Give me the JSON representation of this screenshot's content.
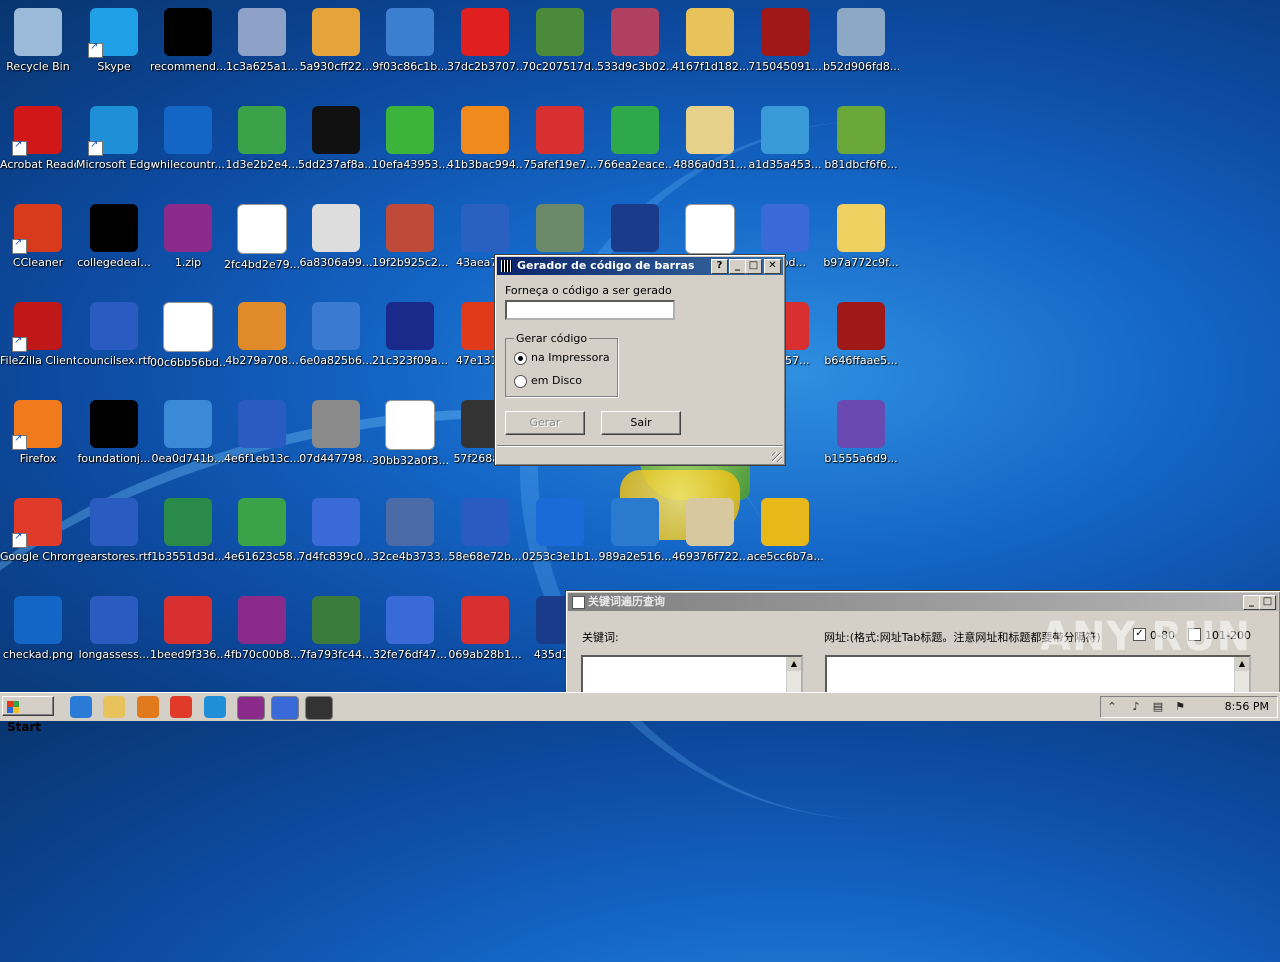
{
  "desktop": {
    "icons": [
      {
        "label": "Recycle Bin",
        "icon": "recycle-bin-icon",
        "color": "#9bb9d8",
        "shortcut": false
      },
      {
        "label": "Skype",
        "icon": "skype-icon",
        "color": "#1e9fe6",
        "shortcut": true
      },
      {
        "label": "recommend...",
        "icon": "black-thumbnail-icon",
        "color": "#000000",
        "shortcut": false
      },
      {
        "label": "1c3a625a1...",
        "icon": "noise-image-icon",
        "color": "#8ea2c8",
        "shortcut": false
      },
      {
        "label": "5a930cff22...",
        "icon": "package-icon",
        "color": "#e6a33a",
        "shortcut": false
      },
      {
        "label": "9f03c86c1b...",
        "icon": "media-player-icon",
        "color": "#3c7fd0",
        "shortcut": false
      },
      {
        "label": "37dc2b3707...",
        "icon": "color-squares-icon",
        "color": "#e02020",
        "shortcut": false
      },
      {
        "label": "70c207517d...",
        "icon": "battery-icon",
        "color": "#4a8a3a",
        "shortcut": false
      },
      {
        "label": "533d9c3b02...",
        "icon": "patterned-cube-icon",
        "color": "#b04060",
        "shortcut": false
      },
      {
        "label": "4167f1d182...",
        "icon": "folder-icon",
        "color": "#e8c25a",
        "shortcut": false
      },
      {
        "label": "715045091...",
        "icon": "pdf-app-icon",
        "color": "#a01818",
        "shortcut": false
      },
      {
        "label": "b52d906fd8...",
        "icon": "recycle-bin-full-icon",
        "color": "#8ca8c4",
        "shortcut": false
      },
      {
        "label": "Acrobat Reader DC",
        "icon": "acrobat-icon",
        "color": "#d01818",
        "shortcut": true
      },
      {
        "label": "Microsoft Edge",
        "icon": "edge-icon",
        "color": "#1f8fd8",
        "shortcut": true
      },
      {
        "label": "whilecountr...",
        "icon": "blank-file-icon",
        "color": "#1466c6",
        "shortcut": false
      },
      {
        "label": "1d3e2b2e4...",
        "icon": "shield-check-icon",
        "color": "#3aa34a",
        "shortcut": false
      },
      {
        "label": "5dd237af8a...",
        "icon": "letter-m-icon",
        "color": "#111111",
        "shortcut": false
      },
      {
        "label": "10efa43953...",
        "icon": "info-icon",
        "color": "#3cb43c",
        "shortcut": false
      },
      {
        "label": "41b3bac994...",
        "icon": "orange-box-icon",
        "color": "#f08a1c",
        "shortcut": false
      },
      {
        "label": "75afef19e7...",
        "icon": "pdf-file-icon",
        "color": "#d83030",
        "shortcut": false
      },
      {
        "label": "766ea2eace...",
        "icon": "green-arrows-icon",
        "color": "#2ea84a",
        "shortcut": false
      },
      {
        "label": "4886a0d31...",
        "icon": "open-book-icon",
        "color": "#e6d08a",
        "shortcut": false
      },
      {
        "label": "a1d35a453...",
        "icon": "lock-icon",
        "color": "#3a9ad8",
        "shortcut": false
      },
      {
        "label": "b81dbcf6f6...",
        "icon": "certificate-icon",
        "color": "#6aa83a",
        "shortcut": false
      },
      {
        "label": "CCleaner",
        "icon": "ccleaner-icon",
        "color": "#d83a1c",
        "shortcut": true
      },
      {
        "label": "collegedeal...",
        "icon": "black-thumbnail-icon",
        "color": "#000000",
        "shortcut": false
      },
      {
        "label": "1.zip",
        "icon": "winrar-icon",
        "color": "#8a2a8a",
        "shortcut": false
      },
      {
        "label": "2fc4bd2e79...",
        "icon": "window-icon",
        "color": "#ffffff",
        "shortcut": false
      },
      {
        "label": "6a8306a99...",
        "icon": "skull-crossbones-icon",
        "color": "#dddddd",
        "shortcut": false
      },
      {
        "label": "19f2b925c2...",
        "icon": "anime-face-icon",
        "color": "#c04a3a",
        "shortcut": false
      },
      {
        "label": "43aea7c...",
        "icon": "network-globe-icon",
        "color": "#2a60c0",
        "shortcut": false
      },
      {
        "label": "",
        "icon": "installer-icon",
        "color": "#6a8a6a",
        "shortcut": false
      },
      {
        "label": "",
        "icon": "clapperboard-icon",
        "color": "#1a3a8a",
        "shortcut": false
      },
      {
        "label": "",
        "icon": "app-window-icon",
        "color": "#ffffff",
        "shortcut": false
      },
      {
        "label": "...9bd...",
        "icon": "broom-icon",
        "color": "#3a6ad8",
        "shortcut": false
      },
      {
        "label": "b97a772c9f...",
        "icon": "folder-icon",
        "color": "#f0d060",
        "shortcut": false
      },
      {
        "label": "FileZilla Client",
        "icon": "filezilla-icon",
        "color": "#c01818",
        "shortcut": true
      },
      {
        "label": "councilsex.rtf",
        "icon": "word-doc-icon",
        "color": "#2a5bc0",
        "shortcut": false
      },
      {
        "label": "00c6bb56bd...",
        "icon": "text-doc-icon",
        "color": "#ffffff",
        "shortcut": false
      },
      {
        "label": "4b279a708...",
        "icon": "java-icon",
        "color": "#e08a2a",
        "shortcut": false
      },
      {
        "label": "6e0a825b6...",
        "icon": "calculator-icon",
        "color": "#3a7ad0",
        "shortcut": false
      },
      {
        "label": "21c323f09a...",
        "icon": "noise-image-icon",
        "color": "#1a2a8a",
        "shortcut": false
      },
      {
        "label": "47e131c...",
        "icon": "colorful-ball-icon",
        "color": "#e03a1a",
        "shortcut": false
      },
      {
        "label": "...5557...",
        "icon": "pdf-file-icon",
        "color": "#d83030",
        "shortcut": false
      },
      {
        "label": "b646ffaae5...",
        "icon": "noise-image-icon",
        "color": "#a01818",
        "shortcut": false
      },
      {
        "label": "Firefox",
        "icon": "firefox-icon",
        "color": "#f07a1c",
        "shortcut": true
      },
      {
        "label": "foundationj...",
        "icon": "black-thumbnail-icon",
        "color": "#000000",
        "shortcut": false
      },
      {
        "label": "0ea0d741b...",
        "icon": "windows-logo-icon",
        "color": "#3a8ad8",
        "shortcut": false
      },
      {
        "label": "4e6f1eb13c...",
        "icon": "word-doc-icon",
        "color": "#2a5bc0",
        "shortcut": false
      },
      {
        "label": "07d447798...",
        "icon": "server-icon",
        "color": "#8a8a8a",
        "shortcut": false
      },
      {
        "label": "30bb32a0f3...",
        "icon": "envelope-icon",
        "color": "#ffffff",
        "shortcut": false
      },
      {
        "label": "57f268a9...",
        "icon": "contact-card-icon",
        "color": "#333333",
        "shortcut": false
      },
      {
        "label": "b1555a6d9...",
        "icon": "stamp-2015-icon",
        "color": "#6a4ab0",
        "shortcut": false
      },
      {
        "label": "Google Chrome",
        "icon": "chrome-icon",
        "color": "#e03a2a",
        "shortcut": true
      },
      {
        "label": "gearstores.rtf",
        "icon": "word-doc-icon",
        "color": "#2a5bc0",
        "shortcut": false
      },
      {
        "label": "1b3551d3d...",
        "icon": "excel-xlsx-icon",
        "color": "#2a8a4a",
        "shortcut": false
      },
      {
        "label": "4e61623c58...",
        "icon": "green-image-icon",
        "color": "#3aa34a",
        "shortcut": false
      },
      {
        "label": "7d4fc839c0...",
        "icon": "setup-window-icon",
        "color": "#3a6ad8",
        "shortcut": false
      },
      {
        "label": "32ce4b3733...",
        "icon": "laptop-icon",
        "color": "#4a6aa8",
        "shortcut": false
      },
      {
        "label": "58e68e72b...",
        "icon": "word-doc-icon",
        "color": "#2a5bc0",
        "shortcut": false
      },
      {
        "label": "0253c3e1b1...",
        "icon": "shield-pulse-icon",
        "color": "#1a6ad8",
        "shortcut": false
      },
      {
        "label": "989a2e516...",
        "icon": "magnifier-monitor-icon",
        "color": "#2a7ad0",
        "shortcut": false
      },
      {
        "label": "469376f722...",
        "icon": "skull-icon",
        "color": "#d8c8a0",
        "shortcut": false
      },
      {
        "label": "ace5cc6b7a...",
        "icon": "key-icon",
        "color": "#e8b81a",
        "shortcut": false
      },
      {
        "label": "checkad.png",
        "icon": "blank-image-icon",
        "color": "#1466c6",
        "shortcut": false
      },
      {
        "label": "longassess...",
        "icon": "word-doc-icon",
        "color": "#2a5bc0",
        "shortcut": false
      },
      {
        "label": "1beed9f336...",
        "icon": "pdf-file-icon",
        "color": "#d83030",
        "shortcut": false
      },
      {
        "label": "4fb70c00b8...",
        "icon": "winrar-icon",
        "color": "#8a2a8a",
        "shortcut": false
      },
      {
        "label": "7fa793fc44...",
        "icon": "books-icon",
        "color": "#3a7a3a",
        "shortcut": false
      },
      {
        "label": "32fe76df47...",
        "icon": "setup-window-icon",
        "color": "#3a6ad8",
        "shortcut": false
      },
      {
        "label": "069ab28b1...",
        "icon": "installer-box-icon",
        "color": "#d83030",
        "shortcut": false
      },
      {
        "label": "435d1a...",
        "icon": "clapperboard-icon",
        "color": "#1a3a8a",
        "shortcut": false
      }
    ]
  },
  "dialog": {
    "title": "Gerador de código de barras",
    "help_btn": "?",
    "min_btn": "_",
    "max_btn": "□",
    "close_btn": "✕",
    "prompt_label": "Forneça o código a ser gerado",
    "code_value": "",
    "group_title": "Gerar código",
    "radio_printer": "na Impressora",
    "radio_disk": "em Disco",
    "selected": "printer",
    "generate_label": "Gerar",
    "exit_label": "Sair"
  },
  "second_window": {
    "title": "关键词遍历查询",
    "min_btn": "_",
    "max_btn": "□",
    "keyword_label": "关键词:",
    "url_label": "网址:(格式:网址Tab标题。注意网址和标题都要带分隔符)",
    "check1_label": "0-80",
    "check2_label": "101-200",
    "check1_checked": true,
    "check2_checked": false
  },
  "taskbar": {
    "start_label": "Start",
    "items": [
      {
        "icon": "ie-icon",
        "color": "#2a7ad8"
      },
      {
        "icon": "explorer-folder-icon",
        "color": "#e8c25a"
      },
      {
        "icon": "media-player-icon",
        "color": "#e07a1c"
      },
      {
        "icon": "chrome-icon",
        "color": "#e03a2a"
      },
      {
        "icon": "edge-icon",
        "color": "#1f8fd8"
      },
      {
        "icon": "winrar-task-icon",
        "color": "#8a2a8a"
      },
      {
        "icon": "setup-task-icon",
        "color": "#3a6ad8"
      },
      {
        "icon": "barcode-task-icon",
        "color": "#333333"
      }
    ],
    "tray": {
      "icons": [
        "chevron-up-icon",
        "speaker-icon",
        "network-icon",
        "flag-icon"
      ],
      "time": "8:56 PM"
    }
  },
  "watermark": "ANY RUN"
}
